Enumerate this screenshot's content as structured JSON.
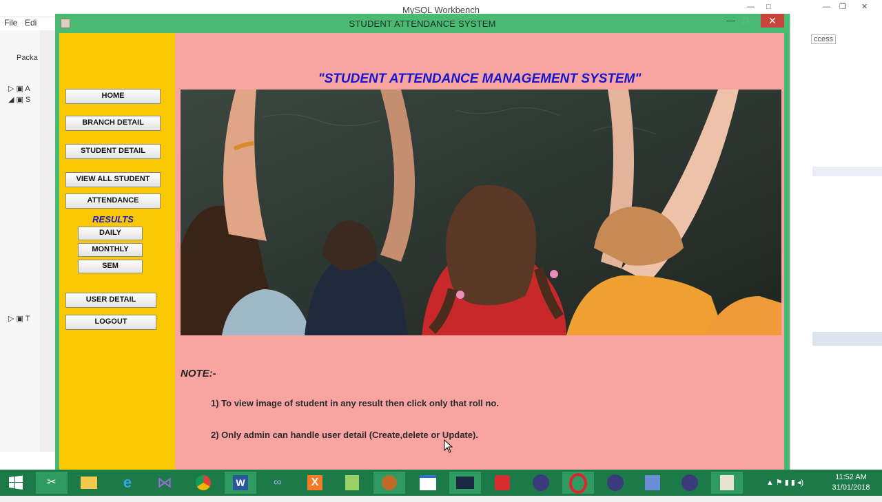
{
  "background_app": {
    "title": "MySQL Workbench",
    "menu": [
      "File",
      "Edi"
    ],
    "left_panel_labels": [
      "Packa",
      "A",
      "S",
      "T"
    ],
    "right_panel_label": "ccess"
  },
  "window": {
    "title": "STUDENT ATTENDANCE SYSTEM",
    "controls": {
      "minimize": "—",
      "maximize": "□",
      "close": "✕"
    }
  },
  "sidebar": {
    "home": "HOME",
    "branch": "BRANCH DETAIL",
    "student": "STUDENT DETAIL",
    "view_all": "VIEW ALL STUDENT",
    "attendance": "ATTENDANCE",
    "results_label": "RESULTS",
    "daily": "DAILY",
    "monthly": "MONTHLY",
    "sem": "SEM",
    "user": "USER DETAIL",
    "logout": "LOGOUT"
  },
  "main": {
    "heading": "\"STUDENT ATTENDANCE MANAGEMENT SYSTEM\"",
    "note_title": "NOTE:-",
    "note1": "1) To view image of student in any result then click only that roll no.",
    "note2": "2) Only admin can handle user detail (Create,delete or Update)."
  },
  "taskbar": {
    "time": "11:52 AM",
    "date": "31/01/2018",
    "icons": [
      "windows-start-icon",
      "snipping-tool-icon",
      "file-explorer-icon",
      "internet-explorer-icon",
      "visual-studio-icon",
      "chrome-icon",
      "word-icon",
      "link-icon",
      "xampp-icon",
      "notepad-plus-icon",
      "android-studio-icon",
      "window-icon",
      "mysql-icon",
      "pen-icon",
      "eclipse-icon",
      "opera-icon",
      "eclipse-icon-2",
      "tools-icon",
      "eclipse-icon-3",
      "java-icon"
    ]
  },
  "colors": {
    "sidebar": "#f9c801",
    "content": "#f8a5a1",
    "frame": "#49ba72",
    "heading": "#1515d0",
    "taskbar": "#1c7a48"
  }
}
